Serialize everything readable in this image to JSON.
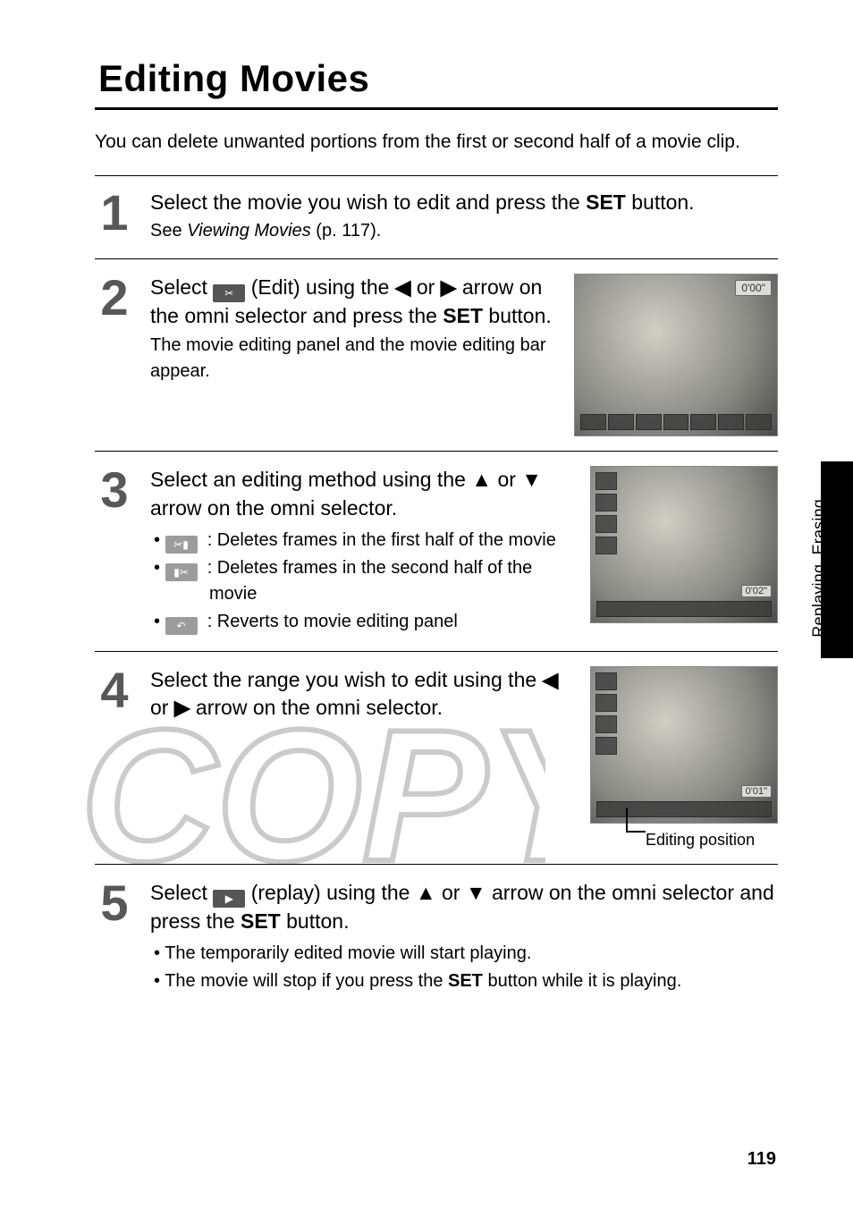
{
  "title": "Editing Movies",
  "intro": "You can delete unwanted portions from the first or second half of a movie clip.",
  "side_label": "Replaying, Erasing",
  "page_number": "119",
  "watermark": "COPY",
  "icons": {
    "edit": "✂",
    "cut_begin": "✂▮",
    "cut_end": "▮✂",
    "undo": "↶",
    "replay": "▶",
    "set": "SET",
    "button_word": "button",
    "left": "◀",
    "right": "▶",
    "up": "▲",
    "down": "▼"
  },
  "screens": {
    "s1_badge": "0'00\"",
    "s2_time": "0'02\"",
    "s3_time": "0'01\""
  },
  "callout": "Editing position",
  "steps": [
    {
      "head_pre": "Select the movie you wish to edit and press the ",
      "head_post": " button.",
      "sub_pre": "See ",
      "sub_it": "Viewing Movies",
      "sub_post": " (p. 117)."
    },
    {
      "head_parts": {
        "p1": "Select ",
        "p2": " (Edit) using the ",
        "p3": " or ",
        "p4": " arrow on the omni selector and press the ",
        "p5": " button."
      },
      "sub": "The movie editing panel and the movie editing bar appear."
    },
    {
      "head_parts": {
        "p1": "Select an editing method using the ",
        "p2": " or ",
        "p3": " arrow on the omni selector."
      },
      "bullets": {
        "b1a": ": Deletes frames in the first half of the movie",
        "b2a": ": Deletes frames in the second half of the",
        "b2b": "movie",
        "b3a": ": Reverts to movie editing panel"
      }
    },
    {
      "head_parts": {
        "p1": "Select the range you wish to edit using the ",
        "p2": " or ",
        "p3": " arrow on the omni selector."
      }
    },
    {
      "head_parts": {
        "p1": "Select ",
        "p2": " (replay) using the ",
        "p3": " or ",
        "p4": " arrow on the omni selector and press the ",
        "p5": " button."
      },
      "bullets": {
        "b1": "The temporarily edited movie will start playing.",
        "b2a": "The movie will stop if you press the ",
        "b2b": " button while it is playing."
      }
    }
  ]
}
